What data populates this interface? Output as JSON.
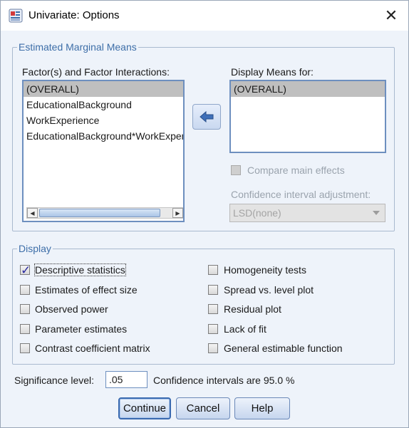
{
  "window": {
    "title": "Univariate: Options",
    "icons": {
      "app": "spss-app-icon",
      "close": "close-icon"
    },
    "close_glyph": "✕"
  },
  "emm": {
    "legend": "Estimated Marginal Means",
    "factors_label": "Factor(s) and Factor Interactions:",
    "factors": [
      "(OVERALL)",
      "EducationalBackground",
      "WorkExperience",
      "EducationalBackground*WorkExperience"
    ],
    "factors_selected_index": 0,
    "display_means_label": "Display Means for:",
    "display_means": [
      "(OVERALL)"
    ],
    "move_button_icon": "arrow-left-icon",
    "compare_main_effects": {
      "label": "Compare main effects",
      "checked": false,
      "enabled": false
    },
    "ci_adjustment_label": "Confidence interval adjustment:",
    "ci_adjustment_value": "LSD(none)"
  },
  "display": {
    "legend": "Display",
    "left": [
      {
        "label": "Descriptive statistics",
        "checked": true
      },
      {
        "label": "Estimates of effect size",
        "checked": false
      },
      {
        "label": "Observed power",
        "checked": false
      },
      {
        "label": "Parameter estimates",
        "checked": false
      },
      {
        "label": "Contrast coefficient matrix",
        "checked": false
      }
    ],
    "right": [
      {
        "label": "Homogeneity tests",
        "checked": false
      },
      {
        "label": "Spread vs. level plot",
        "checked": false
      },
      {
        "label": "Residual plot",
        "checked": false
      },
      {
        "label": "Lack of fit",
        "checked": false
      },
      {
        "label": "General estimable function",
        "checked": false
      }
    ]
  },
  "significance": {
    "label": "Significance level:",
    "value": ".05",
    "ci_text": "Confidence intervals are 95.0 %"
  },
  "buttons": {
    "continue": "Continue",
    "cancel": "Cancel",
    "help": "Help"
  },
  "colors": {
    "legend": "#3d6ea8",
    "background": "#eef3fa",
    "selection": "#bfbfbf"
  }
}
